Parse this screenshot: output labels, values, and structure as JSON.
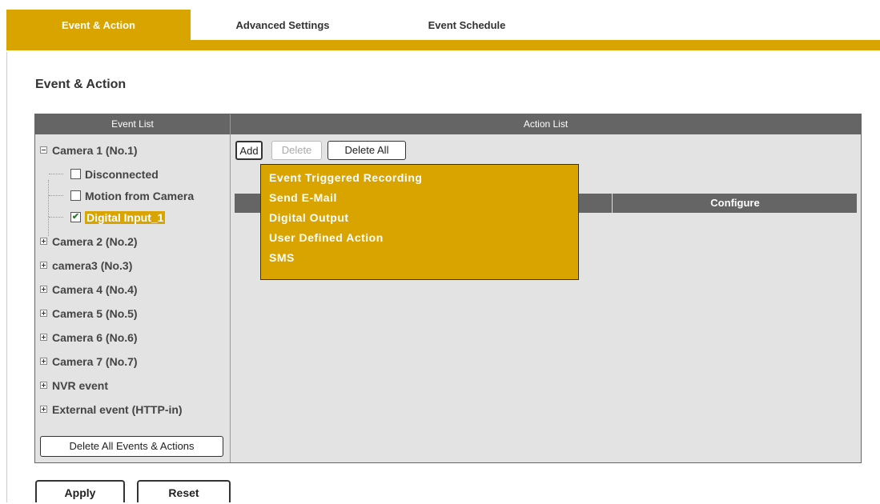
{
  "tabs": [
    {
      "label": "Event & Action",
      "active": true
    },
    {
      "label": "Advanced Settings",
      "active": false
    },
    {
      "label": "Event Schedule",
      "active": false
    }
  ],
  "page_title": "Event & Action",
  "event_list": {
    "header": "Event List",
    "camera1": {
      "label": "Camera 1 (No.1)",
      "children": [
        {
          "label": "Disconnected",
          "checked": false
        },
        {
          "label": "Motion from Camera",
          "checked": false
        },
        {
          "label": "Digital Input_1",
          "checked": true
        }
      ]
    },
    "nodes": [
      "Camera 2 (No.2)",
      "camera3 (No.3)",
      "Camera 4 (No.4)",
      "Camera 5 (No.5)",
      "Camera 6 (No.6)",
      "Camera 7 (No.7)",
      "NVR event",
      "External event (HTTP-in)"
    ],
    "delete_all_button": "Delete All Events & Actions"
  },
  "action_list": {
    "header": "Action List",
    "add_button": "Add",
    "delete_button": "Delete",
    "delete_all_button": "Delete All",
    "configure_column": "Configure",
    "add_menu": [
      "Event Triggered Recording",
      "Send E-Mail",
      "Digital Output",
      "User Defined Action",
      "SMS"
    ]
  },
  "footer": {
    "apply": "Apply",
    "reset": "Reset"
  },
  "colors": {
    "accent": "#d9a400",
    "header_bg": "#656565",
    "panel_bg": "#e3e3e3"
  }
}
